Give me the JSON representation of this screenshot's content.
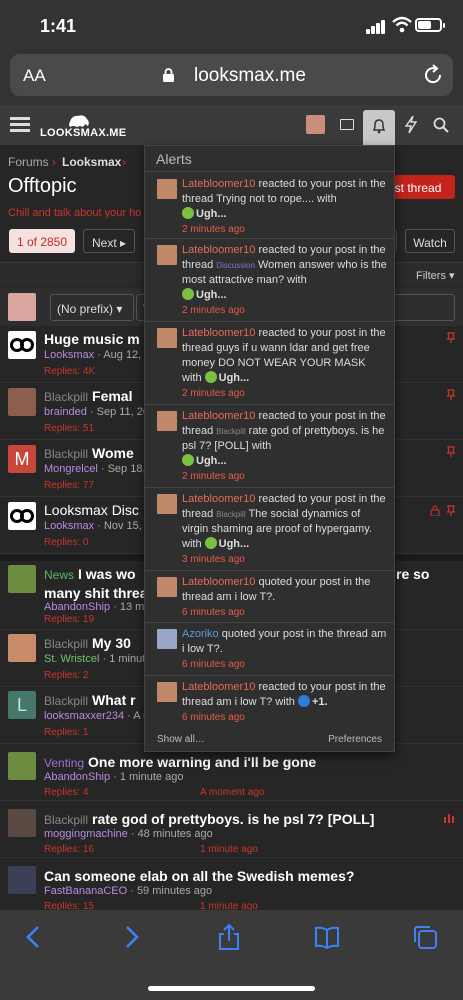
{
  "status": {
    "time": "1:41"
  },
  "browser": {
    "aa": "AA",
    "domain": "looksmax.me"
  },
  "header": {
    "logo": "LOOKSMAX.ME"
  },
  "breadcrumb": {
    "home": "Forums",
    "sep": "›",
    "current": "Looksmax",
    "sep2": "›"
  },
  "page": {
    "title": "Offtopic",
    "description": "Chill and talk about your ho",
    "post_thread": "ost thread",
    "page_of": "1 of 2850",
    "next": "Next ▸",
    "watch": "Watch",
    "filters": "Filters ▾",
    "prefix": "(No prefix) ▾",
    "prefix_rest": "T"
  },
  "threads": [
    {
      "title": "Huge music m",
      "author": "Looksmax",
      "date": "Aug 12, 20",
      "replies": "Replies: 4K"
    },
    {
      "prefix": "Blackpill",
      "title": "Femal",
      "author": "brainded",
      "date": "Sep 11, 202",
      "replies": "Replies: 51"
    },
    {
      "prefix": "Blackpill",
      "title": "Wome",
      "author": "Mongrelcel",
      "date": "Sep 18, 2",
      "replies": "Replies: 77"
    },
    {
      "title": "Looksmax Disc",
      "author": "Looksmax",
      "date": "Nov 15, 20",
      "replies": "Replies: 0"
    },
    {
      "prefix": "News",
      "title": "I was wo",
      "title2": "many shit threa",
      "tail": "re so",
      "author": "AbandonShip",
      "date": "13 min",
      "replies": "Replies: 19"
    },
    {
      "prefix": "Blackpill",
      "title": "My 30",
      "author": "St. Wristcel",
      "date": "1 minute",
      "replies": "Replies: 2"
    },
    {
      "prefix": "Blackpill",
      "title": "What r",
      "author": "looksmaxxer234",
      "date": "A m",
      "replies": "Replies: 1"
    },
    {
      "prefix": "Venting",
      "title": "One more warning and i'll be gone",
      "author": "AbandonShip",
      "date": "1 minute ago",
      "replies": "Replies: 4",
      "last": "A moment ago"
    },
    {
      "prefix": "Blackpill",
      "title": "rate god of prettyboys. is he psl 7? [POLL]",
      "author": "moggingmachine",
      "date": "48 minutes ago",
      "replies": "Replies: 16",
      "last": "1 minute ago"
    },
    {
      "title": "Can someone elab on all the Swedish memes?",
      "author": "FastBananaCEO",
      "date": "59 minutes ago",
      "replies": "Replies: 15",
      "last": "1 minute ago"
    }
  ],
  "alerts": {
    "heading": "Alerts",
    "items": [
      {
        "user": "Latebloomer10",
        "pre": " reacted to your post in the thread ",
        "thread": "Trying not to rope....",
        "post": " with ",
        "reaction": "Ugh...",
        "time": "2 minutes ago"
      },
      {
        "user": "Latebloomer10",
        "pre": " reacted to your post in the thread ",
        "tag": "Discussion",
        "thread": " Women answer who is the most attractive man?",
        "post": " with ",
        "reaction": "Ugh...",
        "time": "2 minutes ago"
      },
      {
        "user": "Latebloomer10",
        "pre": " reacted to your post in the thread ",
        "thread": "guys if u wann ldar and get free money DO NOT WEAR YOUR MASK",
        "post": " with ",
        "reaction": "Ugh...",
        "time": "2 minutes ago"
      },
      {
        "user": "Latebloomer10",
        "pre": " reacted to your post in the thread ",
        "tag": "Blackpill",
        "thread": " rate god of prettyboys. is he psl 7? [POLL]",
        "post": " with ",
        "reaction": "Ugh...",
        "time": "2 minutes ago"
      },
      {
        "user": "Latebloomer10",
        "pre": " reacted to your post in the thread ",
        "tag": "Blackpill",
        "thread": " The social dynamics of virgin shaming are proof of hypergamy.",
        "post": " with ",
        "reaction": "Ugh...",
        "time": "3 minutes ago"
      },
      {
        "user": "Latebloomer10",
        "pre": " quoted your post in the thread ",
        "thread": "am i low T?.",
        "time": "6 minutes ago"
      },
      {
        "user": "Azoriko",
        "pre": " quoted your post in the thread ",
        "thread": "am i low T?.",
        "time": "6 minutes ago"
      },
      {
        "user": "Latebloomer10",
        "pre": " reacted to your post in the thread ",
        "thread": "am i low T?",
        "post": " with ",
        "reaction": "+1.",
        "time": "6 minutes ago"
      }
    ],
    "show_all": "Show all…",
    "preferences": "Preferences"
  }
}
